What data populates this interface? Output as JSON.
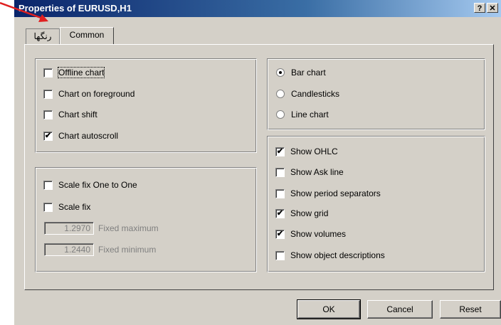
{
  "window": {
    "title": "Properties of EURUSD,H1",
    "help_glyph": "?",
    "close_glyph": "✕"
  },
  "tabs": [
    {
      "label": "رنگها",
      "active": false
    },
    {
      "label": "Common",
      "active": true
    }
  ],
  "options_group": {
    "items": [
      {
        "label": "Offline chart",
        "checked": false
      },
      {
        "label": "Chart on foreground",
        "checked": false
      },
      {
        "label": "Chart shift",
        "checked": false
      },
      {
        "label": "Chart autoscroll",
        "checked": true
      }
    ]
  },
  "scale_group": {
    "items": [
      {
        "label": "Scale fix One to One",
        "checked": false
      },
      {
        "label": "Scale fix",
        "checked": false
      }
    ],
    "fixed_maximum": {
      "value": "1.2970",
      "label": "Fixed maximum"
    },
    "fixed_minimum": {
      "value": "1.2440",
      "label": "Fixed minimum"
    }
  },
  "chart_type_group": {
    "items": [
      {
        "label": "Bar chart",
        "selected": true
      },
      {
        "label": "Candlesticks",
        "selected": false
      },
      {
        "label": "Line chart",
        "selected": false
      }
    ]
  },
  "display_group": {
    "items": [
      {
        "label": "Show OHLC",
        "checked": true
      },
      {
        "label": "Show Ask line",
        "checked": false
      },
      {
        "label": "Show period separators",
        "checked": false
      },
      {
        "label": "Show grid",
        "checked": true
      },
      {
        "label": "Show volumes",
        "checked": true
      },
      {
        "label": "Show object descriptions",
        "checked": false
      }
    ]
  },
  "buttons": {
    "ok": "OK",
    "cancel": "Cancel",
    "reset": "Reset"
  },
  "check_glyph": "✔",
  "annotation_color": "#e02020"
}
